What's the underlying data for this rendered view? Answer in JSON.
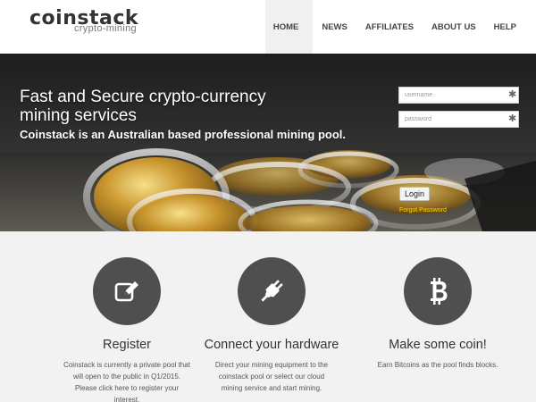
{
  "brand": {
    "name": "coinstack",
    "tagline": "crypto-mining"
  },
  "nav": {
    "items": [
      {
        "label": "HOME",
        "active": true
      },
      {
        "label": "NEWS"
      },
      {
        "label": "AFFILIATES"
      },
      {
        "label": "ABOUT US"
      },
      {
        "label": "HELP"
      }
    ]
  },
  "hero": {
    "title": "Fast and Secure crypto-currency mining services",
    "subtitle": "Coinstack is an Australian based professional mining pool."
  },
  "login": {
    "username_placeholder": "username",
    "password_placeholder": "password",
    "required_marker": "✱",
    "button_label": "Login",
    "forgot_link": "Forgot Password"
  },
  "features": [
    {
      "icon": "edit-icon",
      "title": "Register",
      "text": "Coinstack is currently a private pool that will open to the public in Q1/2015. Please click here to register your interest."
    },
    {
      "icon": "plug-icon",
      "title": "Connect your hardware",
      "text": "Direct your mining equipment to the coinstack pool or select our cloud mining service and start mining."
    },
    {
      "icon": "bitcoin-icon",
      "title": "Make some coin!",
      "text": "Earn Bitcoins as the pool finds blocks."
    }
  ],
  "colors": {
    "accent": "#ffd600",
    "icon_circle": "#4f4f4f",
    "background": "#f2f2f2"
  }
}
